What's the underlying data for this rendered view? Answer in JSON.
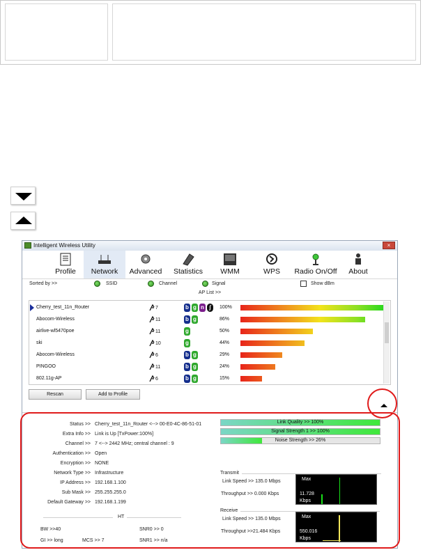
{
  "window": {
    "title": "Intelligent Wireless Utility",
    "close_label": "×"
  },
  "toolbar": [
    {
      "label": "Profile",
      "icon": "profile-icon"
    },
    {
      "label": "Network",
      "icon": "network-icon"
    },
    {
      "label": "Advanced",
      "icon": "advanced-icon"
    },
    {
      "label": "Statistics",
      "icon": "statistics-icon"
    },
    {
      "label": "WMM",
      "icon": "wmm-icon"
    },
    {
      "label": "WPS",
      "icon": "wps-icon"
    },
    {
      "label": "Radio On/Off",
      "icon": "radio-icon"
    },
    {
      "label": "About",
      "icon": "about-icon"
    }
  ],
  "sort": {
    "label": "Sorted by >>",
    "ssid": "SSID",
    "channel": "Channel",
    "signal": "Signal",
    "show_dbm": "Show dBm"
  },
  "ap_list_label": "AP List >>",
  "ap_list": [
    {
      "ssid": "Cherry_test_11n_Router",
      "channel": "7",
      "badges": [
        "b",
        "g",
        "n",
        "w"
      ],
      "pct": "100%",
      "signal": 1.0
    },
    {
      "ssid": "Abocom-Wireless",
      "channel": "11",
      "badges": [
        "b",
        "g"
      ],
      "pct": "86%",
      "signal": 0.86
    },
    {
      "ssid": "airlive-wl5470poe",
      "channel": "11",
      "badges": [
        "g"
      ],
      "pct": "50%",
      "signal": 0.5
    },
    {
      "ssid": "ski",
      "channel": "10",
      "badges": [
        "g"
      ],
      "pct": "44%",
      "signal": 0.44
    },
    {
      "ssid": "Abocom-Wireless",
      "channel": "6",
      "badges": [
        "b",
        "g"
      ],
      "pct": "29%",
      "signal": 0.29
    },
    {
      "ssid": "PINGOO",
      "channel": "11",
      "badges": [
        "b",
        "g"
      ],
      "pct": "24%",
      "signal": 0.24
    },
    {
      "ssid": "802.11g-AP",
      "channel": "6",
      "badges": [
        "b",
        "g"
      ],
      "pct": "15%",
      "signal": 0.15
    }
  ],
  "buttons": {
    "rescan": "Rescan",
    "add_to_profile": "Add to Profile"
  },
  "info": {
    "status": {
      "key": "Status >>",
      "value": "Cherry_test_11n_Router <--> 00-E0-4C-86-51-01"
    },
    "extra": {
      "key": "Extra Info >>",
      "value": "Link is Up [TxPower:100%]"
    },
    "channel": {
      "key": "Channel >>",
      "value": "7 <--> 2442 MHz; central channel : 9"
    },
    "auth": {
      "key": "Authentication >>",
      "value": "Open"
    },
    "enc": {
      "key": "Encryption >>",
      "value": "NONE"
    },
    "nettype": {
      "key": "Network Type >>",
      "value": "Infrastructure"
    },
    "ip": {
      "key": "IP Address >>",
      "value": "192.168.1.100"
    },
    "mask": {
      "key": "Sub Mask >>",
      "value": "255.255.255.0"
    },
    "gw": {
      "key": "Default Gateway >>",
      "value": "192.168.1.199"
    }
  },
  "quality": [
    {
      "label": "Link Quality >> 100%",
      "level": 1.0
    },
    {
      "label": "Signal Strength 1 >> 100%",
      "level": 1.0
    },
    {
      "label": "Noise Strength >> 26%",
      "level": 0.26
    }
  ],
  "ht": {
    "title": "HT",
    "bw": "BW >>40",
    "gi": "GI >> long",
    "mcs": "MCS >>  7",
    "snr0": "SNR0 >>  0",
    "snr1": "SNR1 >> n/a"
  },
  "transmit": {
    "title": "Transmit",
    "link_speed": "Link Speed >> 135.0 Mbps",
    "throughput": "Throughput >> 0.000 Kbps",
    "max": "Max",
    "value": "11.728",
    "unit": "Kbps"
  },
  "receive": {
    "title": "Receive",
    "link_speed": "Link Speed >> 135.0 Mbps",
    "throughput": "Throughput >>21.484 Kbps",
    "max": "Max",
    "value": "550.016",
    "unit": "Kbps"
  },
  "colors": {
    "highlight": "#e01a1a",
    "graph_line": "#19e019",
    "selected": "#1b2f9b"
  }
}
